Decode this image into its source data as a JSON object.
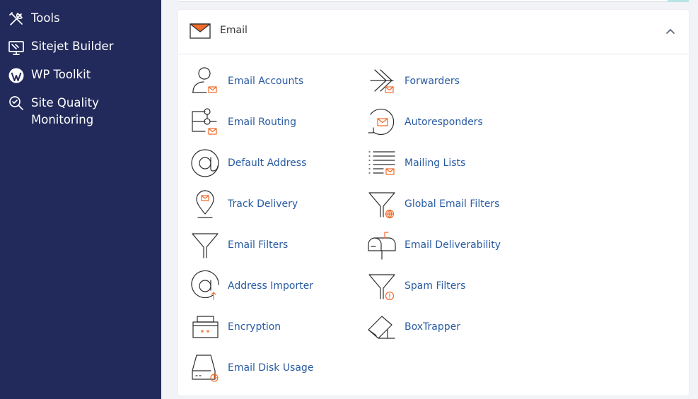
{
  "sidebar": {
    "items": [
      {
        "label": "Tools",
        "icon": "tools-icon"
      },
      {
        "label": "Sitejet Builder",
        "icon": "sitejet-icon"
      },
      {
        "label": "WP Toolkit",
        "icon": "wordpress-icon"
      },
      {
        "label": "Site Quality\nMonitoring",
        "icon": "magnifier-icon"
      }
    ]
  },
  "panel": {
    "title": "Email",
    "icon": "envelope-icon",
    "collapse_icon": "chevron-up-icon"
  },
  "tools": {
    "left": [
      {
        "label": "Email Accounts",
        "icon": "email-accounts-icon"
      },
      {
        "label": "Email Routing",
        "icon": "email-routing-icon"
      },
      {
        "label": "Default Address",
        "icon": "at-sign-icon"
      },
      {
        "label": "Track Delivery",
        "icon": "location-pin-icon"
      },
      {
        "label": "Email Filters",
        "icon": "filter-icon"
      },
      {
        "label": "Address Importer",
        "icon": "address-importer-icon"
      },
      {
        "label": "Encryption",
        "icon": "encryption-icon"
      },
      {
        "label": "Email Disk Usage",
        "icon": "disk-usage-icon"
      }
    ],
    "right": [
      {
        "label": "Forwarders",
        "icon": "forwarders-icon"
      },
      {
        "label": "Autoresponders",
        "icon": "autoresponders-icon"
      },
      {
        "label": "Mailing Lists",
        "icon": "mailing-lists-icon"
      },
      {
        "label": "Global Email Filters",
        "icon": "global-filter-icon"
      },
      {
        "label": "Email Deliverability",
        "icon": "mailbox-icon"
      },
      {
        "label": "Spam Filters",
        "icon": "spam-filter-icon"
      },
      {
        "label": "BoxTrapper",
        "icon": "boxtrapper-icon"
      }
    ]
  },
  "colors": {
    "sidebar_bg": "#222a5b",
    "link": "#295ba2",
    "accent": "#f26c2b",
    "page_bg": "#f2f3f6"
  }
}
